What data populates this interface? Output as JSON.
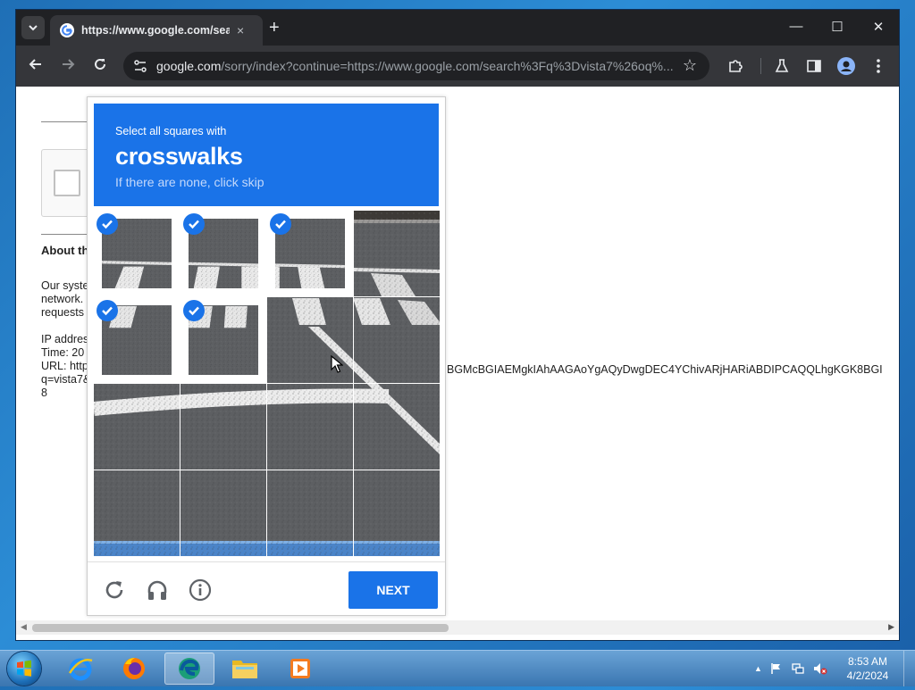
{
  "browser": {
    "tab": {
      "title": "https://www.google.com/search",
      "favicon": "google-g-icon",
      "close": "×"
    },
    "new_tab": "+",
    "window_controls": {
      "minimize": "—",
      "maximize": "☐",
      "close": "✕"
    },
    "url": {
      "host": "google.com",
      "rest": "/sorry/index?continue=https://www.google.com/search%3Fq%3Dvista7%26oq%..."
    }
  },
  "page": {
    "about_heading": "About th",
    "body_lines": [
      "Our syste",
      "network.",
      "requests"
    ],
    "ip_line": "IP addres",
    "time_line": "Time: 20",
    "url_line": "URL: http",
    "q_line": "q=vista7&",
    "eight": "8",
    "url_tail": "BGMcBGIAEMgkIAhAAGAoYgAQyDwgDEC4YChivARjHARiABDIPCAQQLhgKGK8BGI"
  },
  "captcha": {
    "instruction": "Select all squares with",
    "keyword": "crosswalks",
    "skip_hint": "If there are none, click skip",
    "tiles": [
      {
        "selected": true
      },
      {
        "selected": true
      },
      {
        "selected": true
      },
      {
        "selected": false
      },
      {
        "selected": true
      },
      {
        "selected": true
      },
      {
        "selected": false
      },
      {
        "selected": false
      },
      {
        "selected": false
      },
      {
        "selected": false
      },
      {
        "selected": false
      },
      {
        "selected": false
      },
      {
        "selected": false
      },
      {
        "selected": false
      },
      {
        "selected": false
      },
      {
        "selected": false
      }
    ],
    "next_label": "NEXT",
    "footer_icons": [
      "reload-icon",
      "audio-headphones-icon",
      "info-icon"
    ],
    "accent": "#1a73e8"
  },
  "taskbar": {
    "apps": [
      "internet-explorer-icon",
      "firefox-icon",
      "edge-icon",
      "file-explorer-icon",
      "media-player-icon"
    ],
    "clock": {
      "time": "8:53 AM",
      "date": "4/2/2024"
    }
  }
}
